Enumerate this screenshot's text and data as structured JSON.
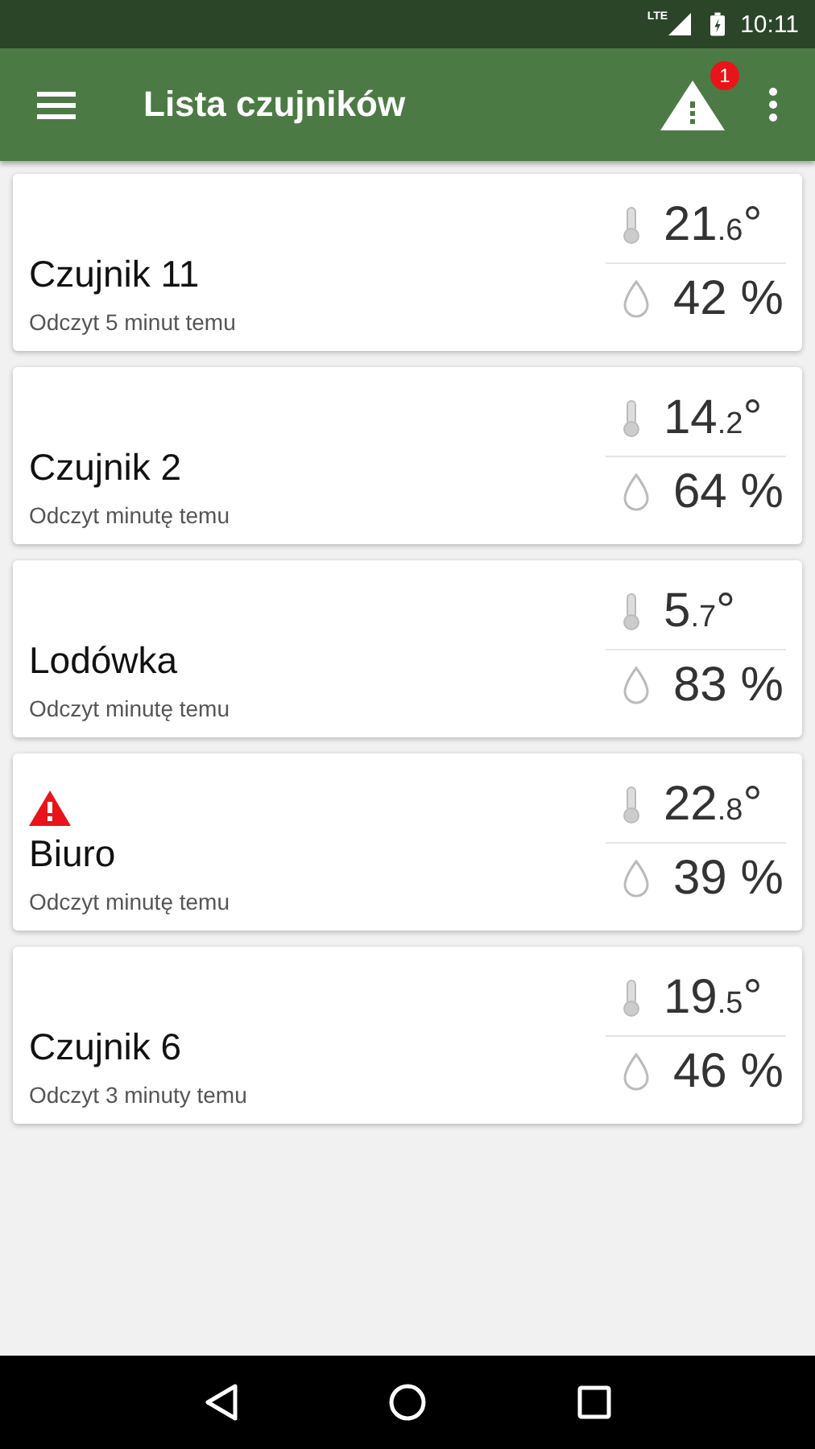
{
  "status_bar": {
    "network": "LTE",
    "time": "10:11"
  },
  "app_bar": {
    "title": "Lista czujników",
    "alert_badge": "1"
  },
  "sensors": [
    {
      "name": "Czujnik 11",
      "reading_time": "Odczyt 5 minut temu",
      "alert": false,
      "temperature": {
        "whole": "21",
        "fraction": ".6",
        "unit": "°"
      },
      "humidity": "42 %"
    },
    {
      "name": "Czujnik 2",
      "reading_time": "Odczyt minutę temu",
      "alert": false,
      "temperature": {
        "whole": "14",
        "fraction": ".2",
        "unit": "°"
      },
      "humidity": "64 %"
    },
    {
      "name": "Lodówka",
      "reading_time": "Odczyt minutę temu",
      "alert": false,
      "temperature": {
        "whole": "5",
        "fraction": ".7",
        "unit": "°"
      },
      "humidity": "83 %"
    },
    {
      "name": "Biuro",
      "reading_time": "Odczyt minutę temu",
      "alert": true,
      "temperature": {
        "whole": "22",
        "fraction": ".8",
        "unit": "°"
      },
      "humidity": "39 %"
    },
    {
      "name": "Czujnik 6",
      "reading_time": "Odczyt 3 minuty temu",
      "alert": false,
      "temperature": {
        "whole": "19",
        "fraction": ".5",
        "unit": "°"
      },
      "humidity": "46 %"
    }
  ]
}
